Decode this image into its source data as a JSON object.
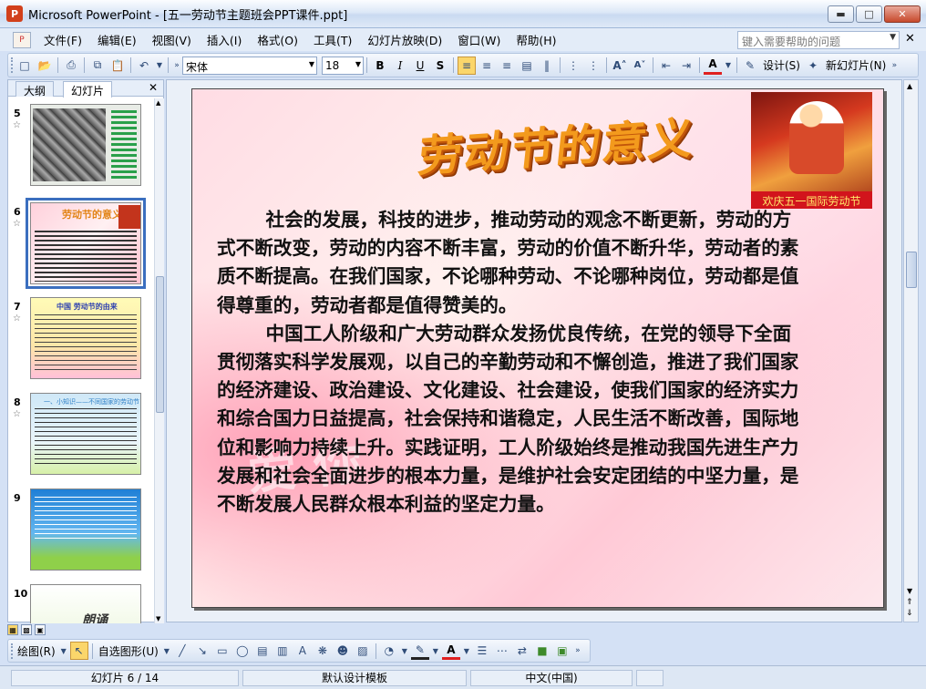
{
  "window": {
    "title": "Microsoft PowerPoint - [五一劳动节主题班会PPT课件.ppt]"
  },
  "menu": {
    "items": [
      "文件(F)",
      "编辑(E)",
      "视图(V)",
      "插入(I)",
      "格式(O)",
      "工具(T)",
      "幻灯片放映(D)",
      "窗口(W)",
      "帮助(H)"
    ],
    "help_placeholder": "键入需要帮助的问题"
  },
  "toolbar": {
    "font_name": "宋体",
    "font_size": "18",
    "design_label": "设计(S)",
    "new_slide_label": "新幻灯片(N)"
  },
  "pane": {
    "tabs": [
      "大纲",
      "幻灯片"
    ],
    "selected_tab": "幻灯片"
  },
  "thumbnails": [
    {
      "num": "5",
      "color": "#e8ece6",
      "title": ""
    },
    {
      "num": "6",
      "color": "#ffd1dc",
      "title": "劳动节的意义"
    },
    {
      "num": "7",
      "color": "#fffbb7",
      "title": "中国 劳动节的由来"
    },
    {
      "num": "8",
      "color": "#cfe8f7",
      "title": "一、小知识——不同国家的劳动节"
    },
    {
      "num": "9",
      "color": "#2d8be0",
      "title": ""
    },
    {
      "num": "10",
      "color": "#ffffff",
      "title": "朗诵"
    }
  ],
  "slide": {
    "title": "劳动节的意义",
    "image_caption": "欢庆五一国际劳动节",
    "watermark": "爱 你",
    "paragraphs": [
      "社会的发展，科技的进步，推动劳动的观念不断更新，劳动的方式不断改变，劳动的内容不断丰富，劳动的价值不断升华，劳动者的素质不断提高。在我们国家，不论哪种劳动、不论哪种岗位，劳动都是值得尊重的，劳动者都是值得赞美的。",
      "中国工人阶级和广大劳动群众发扬优良传统，在党的领导下全面贯彻落实科学发展观，以自己的辛勤劳动和不懈创造，推进了我们国家的经济建设、政治建设、文化建设、社会建设，使我们国家的经济实力和综合国力日益提高，社会保持和谐稳定，人民生活不断改善，国际地位和影响力持续上升。实践证明，工人阶级始终是推动我国先进生产力发展和社会全面进步的根本力量，是维护社会安定团结的中坚力量，是不断发展人民群众根本利益的坚定力量。"
    ]
  },
  "drawbar": {
    "draw_label": "绘图(R)",
    "autoshape_label": "自选图形(U)"
  },
  "status": {
    "slide_info": "幻灯片 6 / 14",
    "template": "默认设计模板",
    "language": "中文(中国)"
  }
}
